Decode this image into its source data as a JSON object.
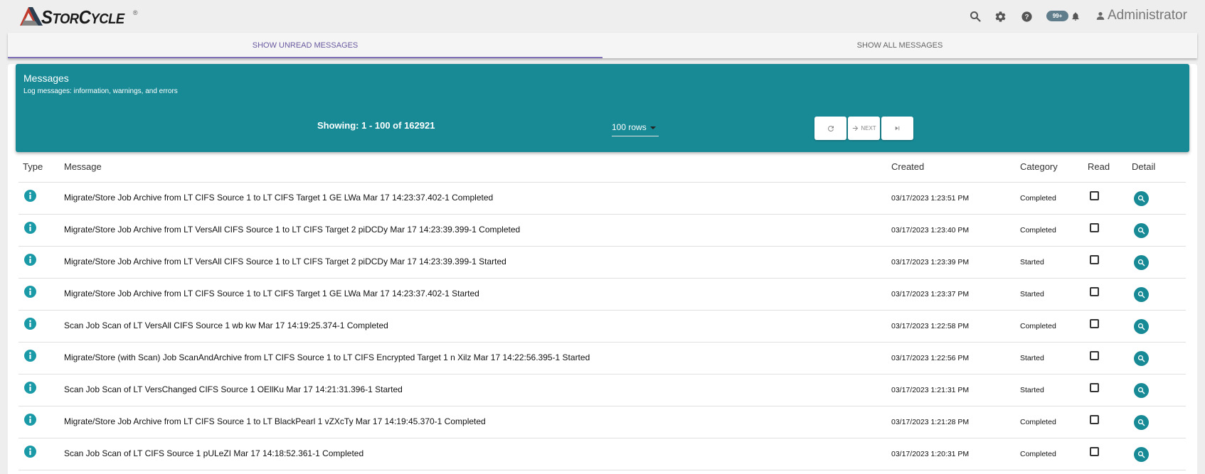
{
  "app": {
    "logo_text_big": "S",
    "logo_text_a": "TOR",
    "logo_text_c": "C",
    "logo_text_b": "YCLE",
    "logo_reg": "®"
  },
  "topbar": {
    "icons": [
      "search-icon",
      "gear-icon",
      "help-icon",
      "bell-icon",
      "person-icon"
    ],
    "badge": "99+",
    "user": "Administrator"
  },
  "tabs": [
    {
      "label": "SHOW UNREAD MESSAGES",
      "active": true
    },
    {
      "label": "SHOW ALL MESSAGES",
      "active": false
    }
  ],
  "header": {
    "title": "Messages",
    "subtitle": "Log messages: information, warnings, and errors",
    "showing": "Showing: 1 - 100 of 162921",
    "rows": "100 rows",
    "next_label": "NEXT"
  },
  "table": {
    "columns": [
      "Type",
      "Message",
      "Created",
      "Category",
      "Read",
      "Detail"
    ],
    "rows": [
      {
        "message": "Migrate/Store Job Archive from LT CIFS Source 1 to LT CIFS Target 1 GE LWa Mar 17 14:23:37.402-1 Completed",
        "created": "03/17/2023 1:23:51 PM",
        "category": "Completed"
      },
      {
        "message": "Migrate/Store Job Archive from LT VersAll CIFS Source 1 to LT CIFS Target 2 piDCDy Mar 17 14:23:39.399-1 Completed",
        "created": "03/17/2023 1:23:40 PM",
        "category": "Completed"
      },
      {
        "message": "Migrate/Store Job Archive from LT VersAll CIFS Source 1 to LT CIFS Target 2 piDCDy Mar 17 14:23:39.399-1 Started",
        "created": "03/17/2023 1:23:39 PM",
        "category": "Started"
      },
      {
        "message": "Migrate/Store Job Archive from LT CIFS Source 1 to LT CIFS Target 1 GE LWa Mar 17 14:23:37.402-1 Started",
        "created": "03/17/2023 1:23:37 PM",
        "category": "Started"
      },
      {
        "message": "Scan Job Scan of LT VersAll CIFS Source 1 wb kw Mar 17 14:19:25.374-1 Completed",
        "created": "03/17/2023 1:22:58 PM",
        "category": "Completed"
      },
      {
        "message": "Migrate/Store (with Scan) Job ScanAndArchive from LT CIFS Source 1 to LT CIFS Encrypted Target 1 n Xilz Mar 17 14:22:56.395-1 Started",
        "created": "03/17/2023 1:22:56 PM",
        "category": "Started"
      },
      {
        "message": "Scan Job Scan of LT VersChanged CIFS Source 1 OEllKu Mar 17 14:21:31.396-1 Started",
        "created": "03/17/2023 1:21:31 PM",
        "category": "Started"
      },
      {
        "message": "Migrate/Store Job Archive from LT CIFS Source 1 to LT BlackPearl 1 vZXcTy Mar 17 14:19:45.370-1 Completed",
        "created": "03/17/2023 1:21:28 PM",
        "category": "Completed"
      },
      {
        "message": "Scan Job Scan of LT CIFS Source 1 pULeZI Mar 17 14:18:52.361-1 Completed",
        "created": "03/17/2023 1:20:31 PM",
        "category": "Completed"
      }
    ]
  },
  "colors": {
    "accent": "#178a96",
    "tab_active": "#6a5aa0"
  }
}
